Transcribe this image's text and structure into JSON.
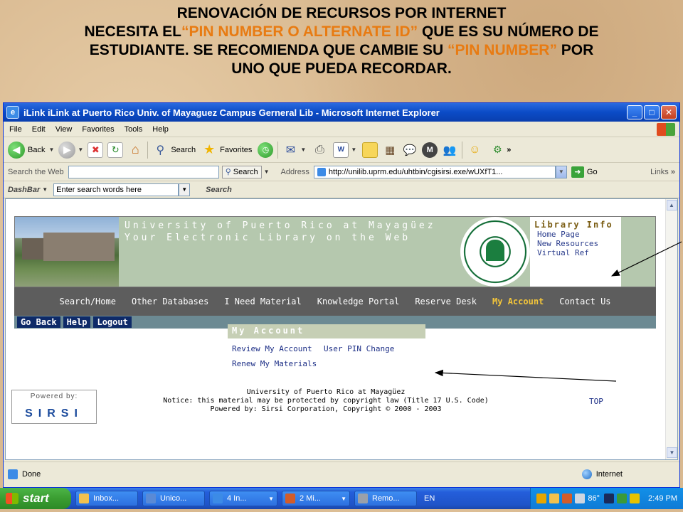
{
  "heading": {
    "line1": "RENOVACIÓN DE RECURSOS  POR INTERNET",
    "line2_pre": "NECESITA EL",
    "line2_hl": "“PIN NUMBER O ALTERNATE ID”",
    "line2_post": " QUE ES SU NÚMERO DE",
    "line3_pre": "ESTUDIANTE. SE RECOMIENDA QUE CAMBIE SU ",
    "line3_hl": "“PIN NUMBER”",
    "line3_post": " POR",
    "line4": "UNO QUE PUEDA RECORDAR."
  },
  "colors": {
    "highlight": "#e87b12",
    "titlebar": "#0b4bc6",
    "nav_active": "#f3c53a"
  },
  "window": {
    "title": "iLink iLink at Puerto Rico Univ. of Mayaguez Campus Gerneral Lib - Microsoft Internet Explorer",
    "buttons": {
      "minimize": "_",
      "maximize": "□",
      "close": "✕"
    }
  },
  "menu": [
    "File",
    "Edit",
    "View",
    "Favorites",
    "Tools",
    "Help"
  ],
  "toolbar": {
    "back": "Back",
    "search": "Search",
    "favorites": "Favorites",
    "more": "»"
  },
  "address": {
    "search_the_web": "Search the Web",
    "search_btn": "Search",
    "label": "Address",
    "url": "http://unilib.uprm.edu/uhtbin/cgisirsi.exe/wUXfT1...",
    "go": "Go",
    "links": "Links",
    "more": "»"
  },
  "dashbar": {
    "label": "DashBar",
    "placeholder": "Enter search words here",
    "search": "Search"
  },
  "library": {
    "banner_line1": "University of Puerto Rico at Mayagüez",
    "banner_line2": "Your Electronic Library on the Web",
    "info_title": "Library Info",
    "info_links": [
      "Home Page",
      "New Resources",
      "Virtual Ref"
    ],
    "nav": [
      "Search/Home",
      "Other Databases",
      "I Need Material",
      "Knowledge Portal",
      "Reserve Desk",
      "My Account",
      "Contact Us"
    ],
    "subnav": [
      "Go Back",
      "Help",
      "Logout"
    ],
    "account_title": "My Account",
    "account_links": [
      "Review My Account",
      "User PIN Change",
      "Renew My Materials"
    ],
    "powered_by": "Powered by:",
    "sirsi": "SIRSI",
    "footer": [
      "University of Puerto Rico at Mayagüez",
      "Notice: this material may be protected by copyright law (Title 17 U.S. Code)",
      "Powered by: Sirsi Corporation, Copyright © 2000 - 2003"
    ],
    "top": "TOP"
  },
  "status": {
    "text": "Done",
    "zone": "Internet"
  },
  "taskbar": {
    "start": "start",
    "tasks": [
      "Inbox...",
      "Unico...",
      "4 In...",
      "2 Mi...",
      "Remo..."
    ],
    "lang": "EN",
    "temp": "86°",
    "time": "2:49 PM"
  }
}
